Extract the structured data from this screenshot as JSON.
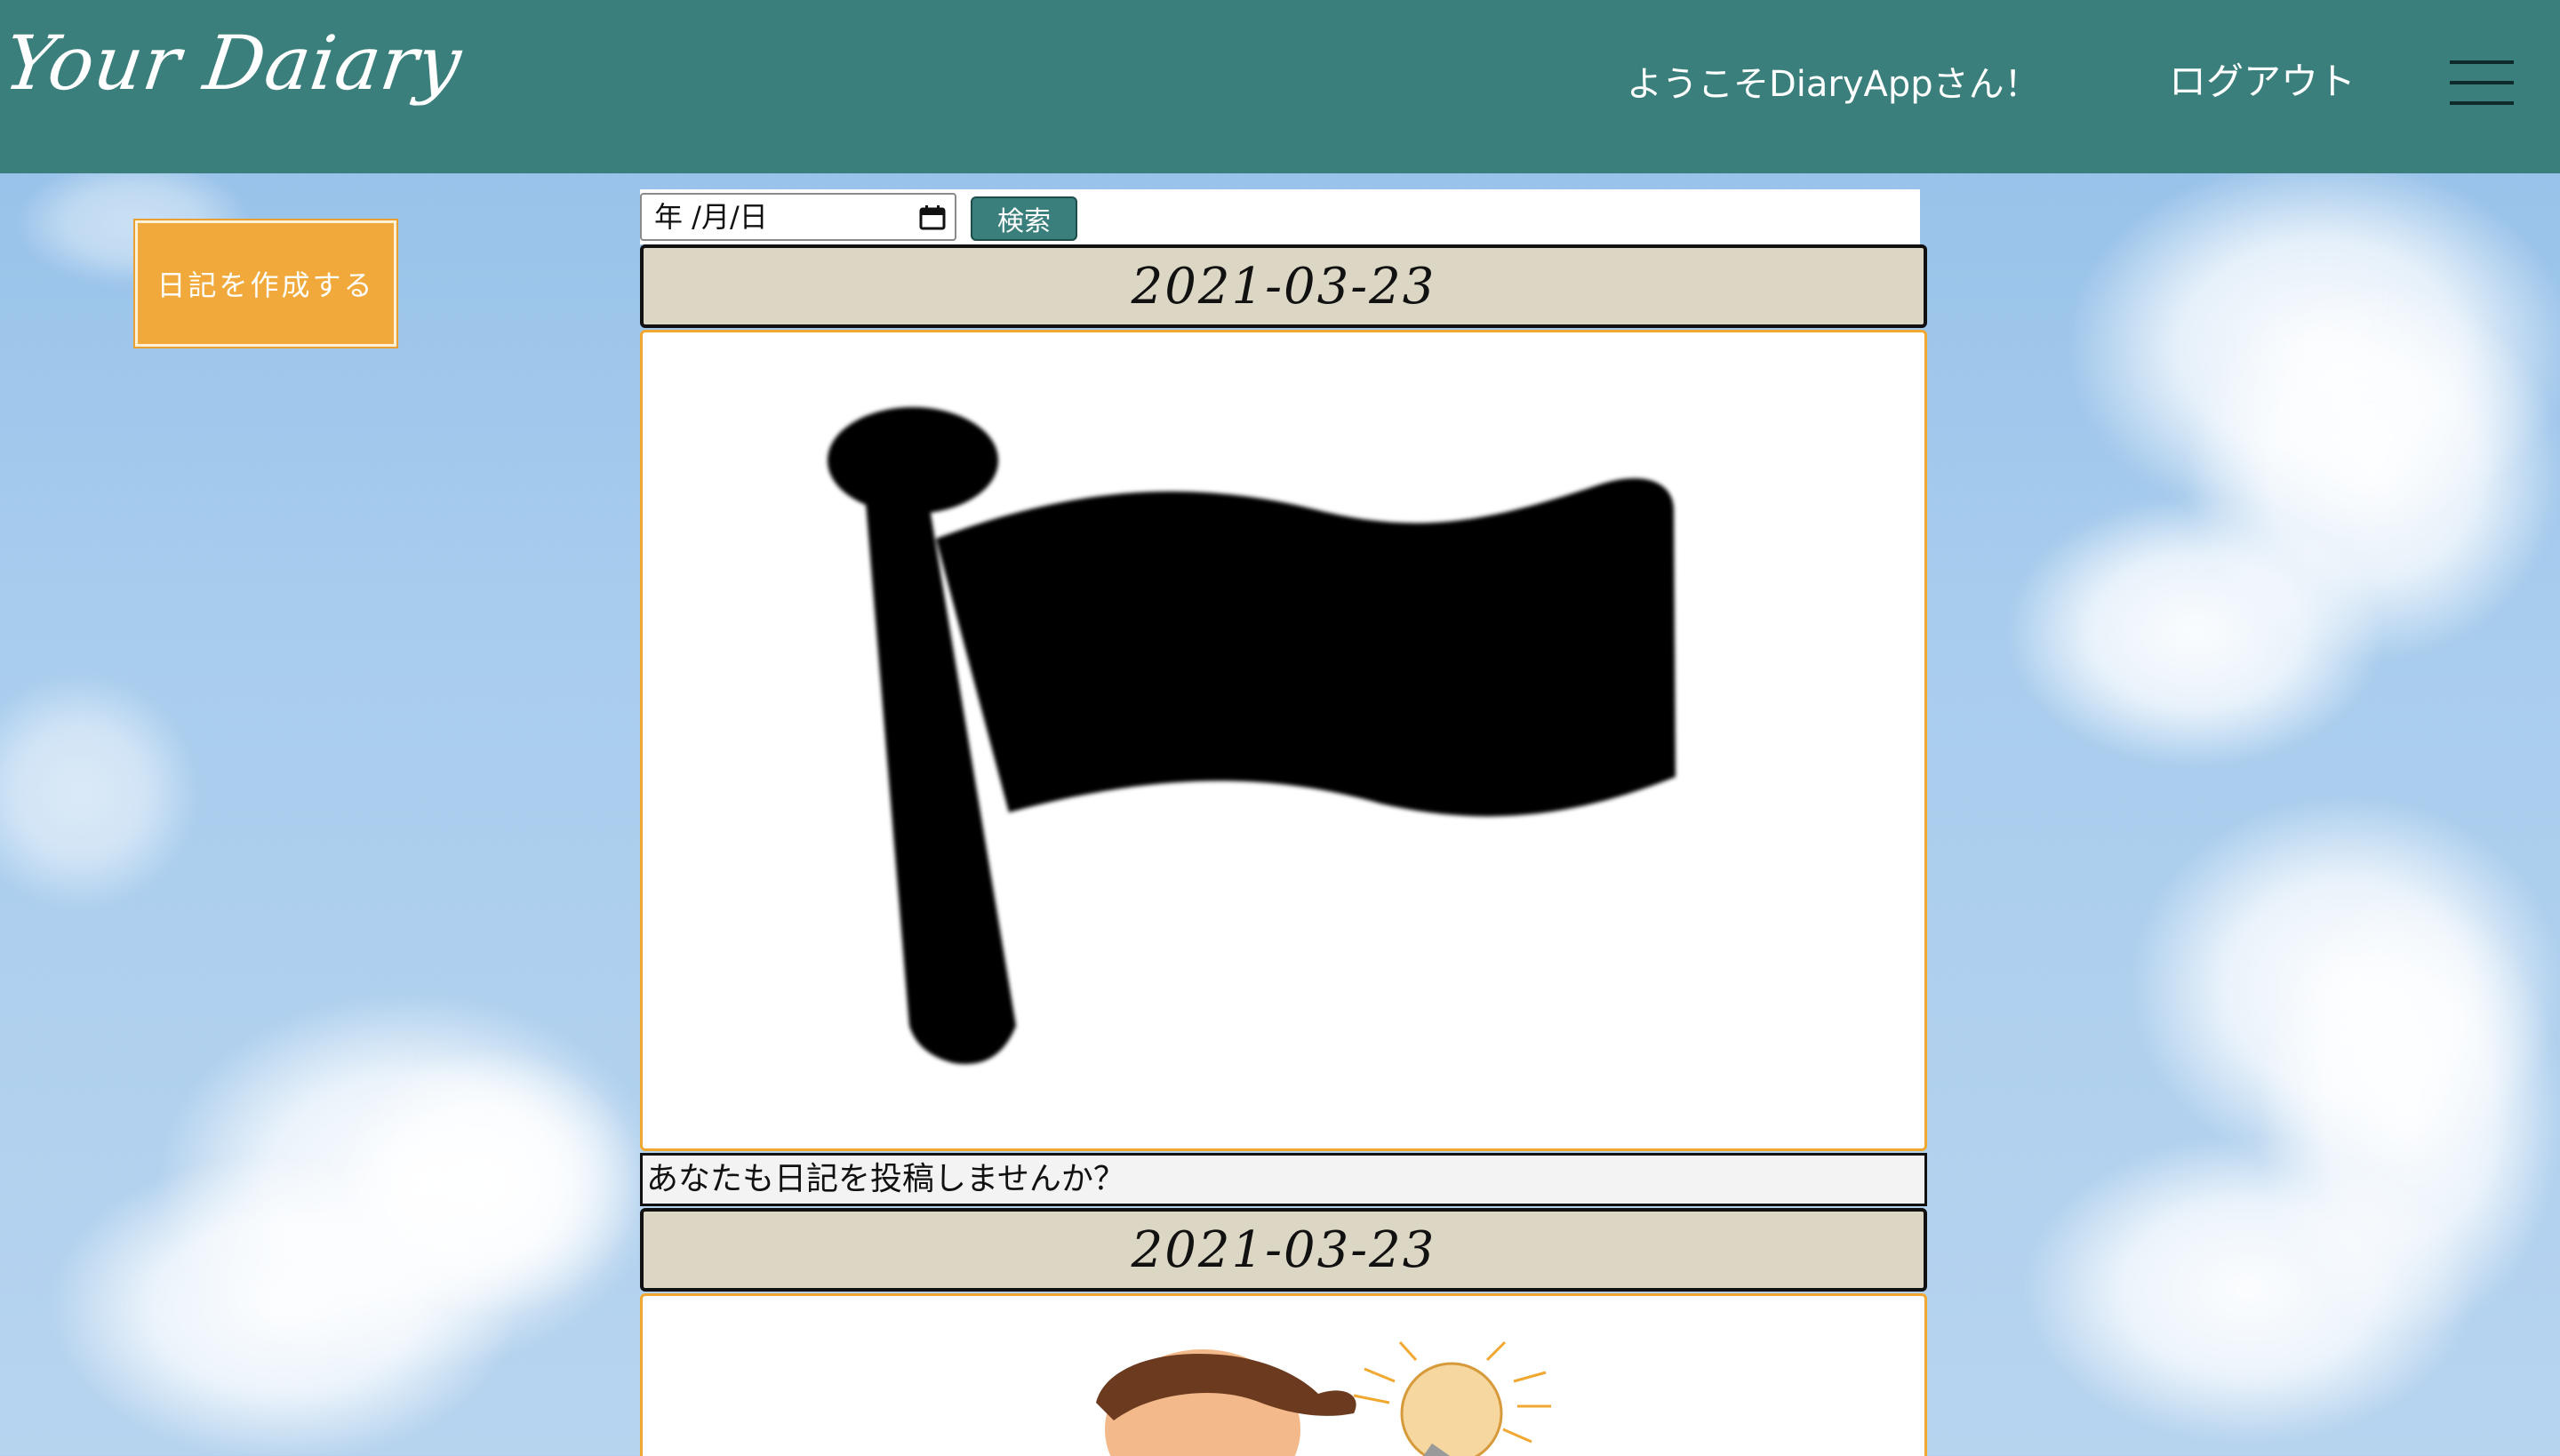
{
  "header": {
    "logo_text": "Your Daiary",
    "welcome_text": "ようこそDiaryAppさん！",
    "logout_label": "ログアウト",
    "menu_icon": "hamburger-menu-icon"
  },
  "sidebar": {
    "create_label": "日記を作成する"
  },
  "search": {
    "date_placeholder": "年 /月/日",
    "button_label": "検索",
    "calendar_icon": "calendar-icon"
  },
  "entries": [
    {
      "date": "2021-03-23",
      "image": "flag-icon",
      "caption": "あなたも日記を投稿しませんか？"
    },
    {
      "date": "2021-03-23",
      "image": "person-with-lightbulb-illustration"
    }
  ],
  "colors": {
    "header_bg": "#3a7f7c",
    "create_button": "#f2a93b",
    "date_header_bg": "#dcd6c4",
    "card_border": "#f0a830"
  }
}
